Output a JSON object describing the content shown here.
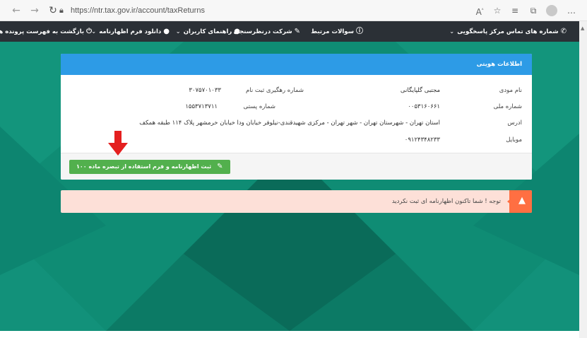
{
  "browser": {
    "url": "https://ntr.tax.gov.ir/account/taxReturns",
    "icons": [
      "back-icon",
      "forward-icon",
      "refresh-icon",
      "lock-icon",
      "read-aloud-icon",
      "favorite-icon",
      "favorites-icon",
      "collections-icon",
      "profile-icon",
      "more-icon"
    ]
  },
  "nav": {
    "contact": "شماره های تماس مرکز پاسخگویی",
    "faq": "سوالات مرتبط",
    "survey": "شرکت درنظرسنجی",
    "guide": "راهنمای کاربران",
    "download": "دانلود فرم اظهارنامه",
    "back": "بازگشت به فهرست پرونده ها"
  },
  "panel": {
    "title": "اطلاعات هویتی",
    "rows": {
      "name_label": "نام مودی",
      "name_value": "مجتبی گلپایگانی",
      "tracking_label": "شماره رهگیری ثبت نام",
      "tracking_value": "۳۰۷۵۷۰۱۰۳۳",
      "national_label": "شماره ملی",
      "national_value": "۰۰۵۳۱۶۰۶۶۱",
      "postal_label": "شماره پستی",
      "postal_value": "۱۵۵۳۷۱۳۷۱۱",
      "address_label": "ادرس",
      "address_value": "استان تهران - شهرستان تهران - شهر تهران - مرکزی شهیدقندی-نیلوفر خیابان ودا خیابان خرمشهر پلاک ۱۱۴ طبقه همکف",
      "mobile_label": "موبایل",
      "mobile_value": "۰۹۱۲۴۳۴۸۲۳۳"
    },
    "button_label": "ثبت اظهارنامه و فرم استفاده از تبصره ماده ۱۰۰"
  },
  "alert": {
    "text": "توجه ! شما تاکنون اظهارنامه ای ثبت نکردید"
  },
  "colors": {
    "nav_bg": "#2b3036",
    "page_bg": "#0f8c74",
    "panel_header": "#2d9be6",
    "button": "#52b04d",
    "alert_bg": "#fde0d8",
    "alert_icon": "#ff6f42",
    "arrow": "#e41f1f"
  }
}
